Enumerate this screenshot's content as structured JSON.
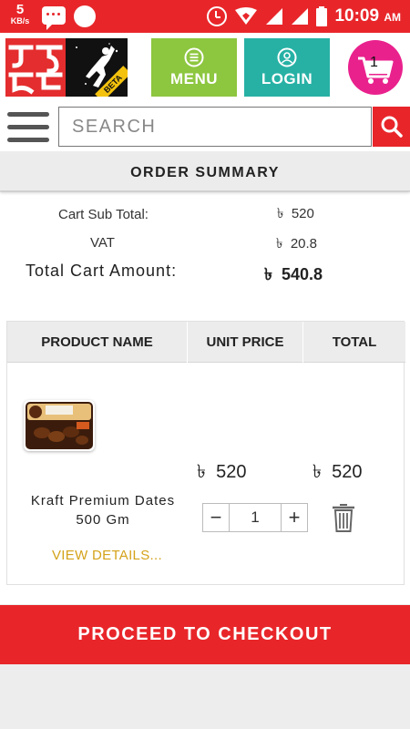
{
  "status_bar": {
    "net_speed": "5",
    "net_unit": "KB/s",
    "time": "10:09",
    "ampm": "AM"
  },
  "header": {
    "logo_badge": "BETA",
    "menu_label": "MENU",
    "login_label": "LOGIN",
    "cart_count": "1",
    "colors": {
      "menu": "#8dc63f",
      "login": "#27b1a5",
      "cart": "#e9218d",
      "brand": "#e8262a"
    }
  },
  "search": {
    "placeholder": "SEARCH",
    "value": ""
  },
  "order_summary": {
    "title": "ORDER SUMMARY",
    "currency": "৳",
    "subtotal_label": "Cart Sub Total:",
    "subtotal_value": "520",
    "vat_label": "VAT",
    "vat_value": "20.8",
    "total_label": "Total Cart Amount:",
    "total_value": "540.8"
  },
  "cart_table": {
    "columns": [
      "PRODUCT NAME",
      "UNIT PRICE",
      "TOTAL"
    ],
    "rows": [
      {
        "name_line1": "Kraft Premium Dates",
        "name_line2": "500 Gm",
        "unit_price": "520",
        "total": "520",
        "quantity": "1",
        "view_details_label": "VIEW DETAILS..."
      }
    ]
  },
  "checkout": {
    "label": "PROCEED TO CHECKOUT"
  }
}
